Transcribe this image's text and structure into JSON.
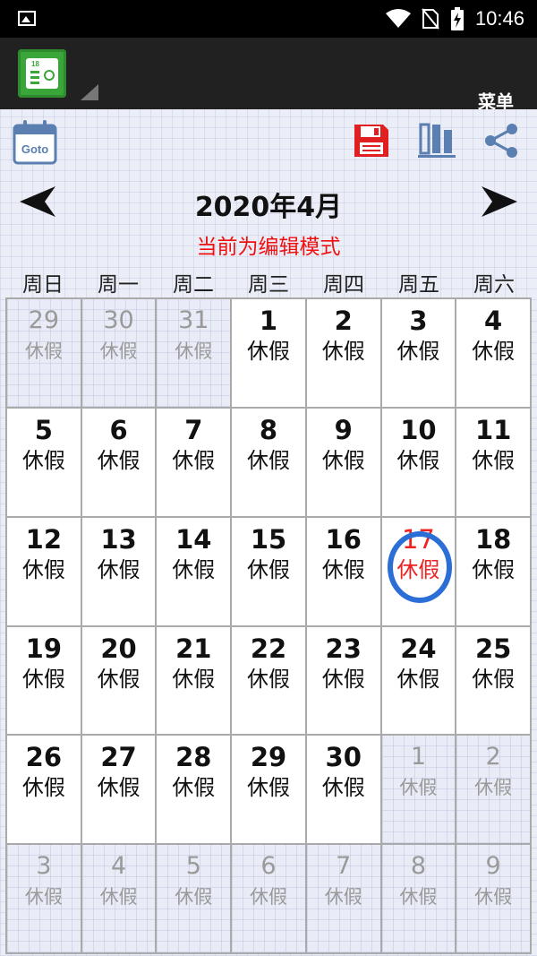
{
  "status_bar": {
    "time": "10:46"
  },
  "app_bar": {
    "menu_label": "菜单"
  },
  "toolbar": {
    "goto_label": "Goto"
  },
  "calendar": {
    "title": "2020年4月",
    "mode_text": "当前为编辑模式",
    "weekdays": [
      "周日",
      "周一",
      "周二",
      "周三",
      "周四",
      "周五",
      "周六"
    ],
    "days": [
      {
        "day": "29",
        "label": "休假",
        "current": false
      },
      {
        "day": "30",
        "label": "休假",
        "current": false
      },
      {
        "day": "31",
        "label": "休假",
        "current": false
      },
      {
        "day": "1",
        "label": "休假",
        "current": true
      },
      {
        "day": "2",
        "label": "休假",
        "current": true
      },
      {
        "day": "3",
        "label": "休假",
        "current": true
      },
      {
        "day": "4",
        "label": "休假",
        "current": true
      },
      {
        "day": "5",
        "label": "休假",
        "current": true
      },
      {
        "day": "6",
        "label": "休假",
        "current": true
      },
      {
        "day": "7",
        "label": "休假",
        "current": true
      },
      {
        "day": "8",
        "label": "休假",
        "current": true
      },
      {
        "day": "9",
        "label": "休假",
        "current": true
      },
      {
        "day": "10",
        "label": "休假",
        "current": true
      },
      {
        "day": "11",
        "label": "休假",
        "current": true
      },
      {
        "day": "12",
        "label": "休假",
        "current": true
      },
      {
        "day": "13",
        "label": "休假",
        "current": true
      },
      {
        "day": "14",
        "label": "休假",
        "current": true
      },
      {
        "day": "15",
        "label": "休假",
        "current": true
      },
      {
        "day": "16",
        "label": "休假",
        "current": true
      },
      {
        "day": "17",
        "label": "休假",
        "current": true,
        "today": true
      },
      {
        "day": "18",
        "label": "休假",
        "current": true
      },
      {
        "day": "19",
        "label": "休假",
        "current": true
      },
      {
        "day": "20",
        "label": "休假",
        "current": true
      },
      {
        "day": "21",
        "label": "休假",
        "current": true
      },
      {
        "day": "22",
        "label": "休假",
        "current": true
      },
      {
        "day": "23",
        "label": "休假",
        "current": true
      },
      {
        "day": "24",
        "label": "休假",
        "current": true
      },
      {
        "day": "25",
        "label": "休假",
        "current": true
      },
      {
        "day": "26",
        "label": "休假",
        "current": true
      },
      {
        "day": "27",
        "label": "休假",
        "current": true
      },
      {
        "day": "28",
        "label": "休假",
        "current": true
      },
      {
        "day": "29",
        "label": "休假",
        "current": true
      },
      {
        "day": "30",
        "label": "休假",
        "current": true
      },
      {
        "day": "1",
        "label": "休假",
        "current": false
      },
      {
        "day": "2",
        "label": "休假",
        "current": false
      },
      {
        "day": "3",
        "label": "休假",
        "current": false
      },
      {
        "day": "4",
        "label": "休假",
        "current": false
      },
      {
        "day": "5",
        "label": "休假",
        "current": false
      },
      {
        "day": "6",
        "label": "休假",
        "current": false
      },
      {
        "day": "7",
        "label": "休假",
        "current": false
      },
      {
        "day": "8",
        "label": "休假",
        "current": false
      },
      {
        "day": "9",
        "label": "休假",
        "current": false
      }
    ]
  },
  "colors": {
    "accent_red": "#e22222",
    "icon_blue": "#5a7fb0",
    "today_circle": "#2b6fd6"
  }
}
